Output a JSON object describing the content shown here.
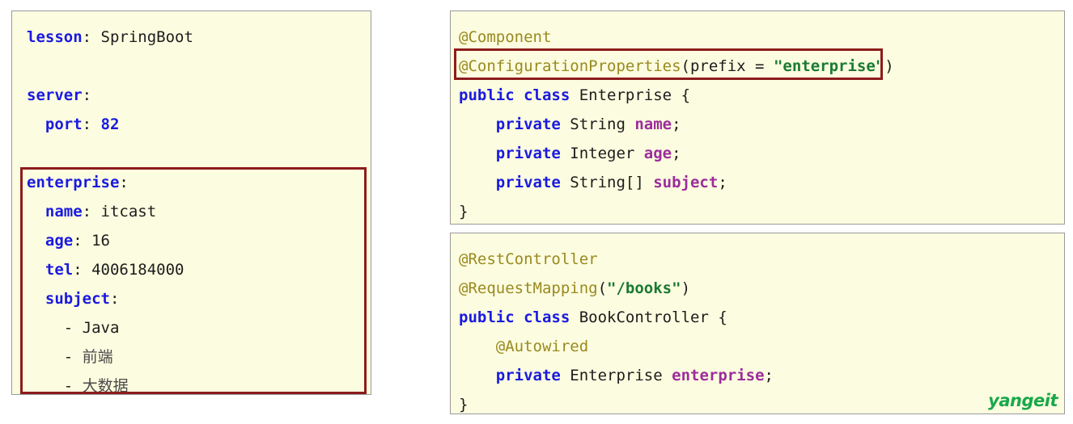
{
  "yaml_panel": {
    "lines": [
      [
        {
          "t": "lesson",
          "c": "key"
        },
        {
          "t": ": ",
          "c": "punc"
        },
        {
          "t": "SpringBoot",
          "c": "plain"
        }
      ],
      [],
      [
        {
          "t": "server",
          "c": "key"
        },
        {
          "t": ":",
          "c": "punc"
        }
      ],
      [
        {
          "t": "  ",
          "c": "plain"
        },
        {
          "t": "port",
          "c": "key"
        },
        {
          "t": ": ",
          "c": "punc"
        },
        {
          "t": "82",
          "c": "num"
        }
      ],
      [],
      [
        {
          "t": "enterprise",
          "c": "key"
        },
        {
          "t": ":",
          "c": "punc"
        }
      ],
      [
        {
          "t": "  ",
          "c": "plain"
        },
        {
          "t": "name",
          "c": "key"
        },
        {
          "t": ": ",
          "c": "punc"
        },
        {
          "t": "itcast",
          "c": "plain"
        }
      ],
      [
        {
          "t": "  ",
          "c": "plain"
        },
        {
          "t": "age",
          "c": "key"
        },
        {
          "t": ": ",
          "c": "punc"
        },
        {
          "t": "16",
          "c": "plain"
        }
      ],
      [
        {
          "t": "  ",
          "c": "plain"
        },
        {
          "t": "tel",
          "c": "key"
        },
        {
          "t": ": ",
          "c": "punc"
        },
        {
          "t": "4006184000",
          "c": "plain"
        }
      ],
      [
        {
          "t": "  ",
          "c": "plain"
        },
        {
          "t": "subject",
          "c": "key"
        },
        {
          "t": ":",
          "c": "punc"
        }
      ],
      [
        {
          "t": "    - ",
          "c": "plain"
        },
        {
          "t": "Java",
          "c": "plain"
        }
      ],
      [
        {
          "t": "    - ",
          "c": "plain"
        },
        {
          "t": "前端",
          "c": "cjk"
        }
      ],
      [
        {
          "t": "    - ",
          "c": "plain"
        },
        {
          "t": "大数据",
          "c": "cjk"
        }
      ]
    ]
  },
  "entity_panel": {
    "lines": [
      [
        {
          "t": "@Component",
          "c": "ann"
        }
      ],
      [
        {
          "t": "@ConfigurationProperties",
          "c": "ann"
        },
        {
          "t": "(prefix = ",
          "c": "punc"
        },
        {
          "t": "\"enterprise\"",
          "c": "str"
        },
        {
          "t": ")",
          "c": "punc"
        }
      ],
      [
        {
          "t": "public",
          "c": "kw"
        },
        {
          "t": " ",
          "c": "plain"
        },
        {
          "t": "class",
          "c": "kw"
        },
        {
          "t": " Enterprise {",
          "c": "type"
        }
      ],
      [
        {
          "t": "    ",
          "c": "plain"
        },
        {
          "t": "private",
          "c": "kw"
        },
        {
          "t": " String ",
          "c": "type"
        },
        {
          "t": "name",
          "c": "field"
        },
        {
          "t": ";",
          "c": "punc"
        }
      ],
      [
        {
          "t": "    ",
          "c": "plain"
        },
        {
          "t": "private",
          "c": "kw"
        },
        {
          "t": " Integer ",
          "c": "type"
        },
        {
          "t": "age",
          "c": "field"
        },
        {
          "t": ";",
          "c": "punc"
        }
      ],
      [
        {
          "t": "    ",
          "c": "plain"
        },
        {
          "t": "private",
          "c": "kw"
        },
        {
          "t": " String[] ",
          "c": "type"
        },
        {
          "t": "subject",
          "c": "field"
        },
        {
          "t": ";",
          "c": "punc"
        }
      ],
      [
        {
          "t": "}",
          "c": "punc"
        }
      ]
    ]
  },
  "controller_panel": {
    "lines": [
      [
        {
          "t": "@RestController",
          "c": "ann"
        }
      ],
      [
        {
          "t": "@RequestMapping",
          "c": "ann"
        },
        {
          "t": "(",
          "c": "punc"
        },
        {
          "t": "\"/books\"",
          "c": "str"
        },
        {
          "t": ")",
          "c": "punc"
        }
      ],
      [
        {
          "t": "public",
          "c": "kw"
        },
        {
          "t": " ",
          "c": "plain"
        },
        {
          "t": "class",
          "c": "kw"
        },
        {
          "t": " BookController {",
          "c": "type"
        }
      ],
      [
        {
          "t": "    ",
          "c": "plain"
        },
        {
          "t": "@Autowired",
          "c": "ann"
        }
      ],
      [
        {
          "t": "    ",
          "c": "plain"
        },
        {
          "t": "private",
          "c": "kw"
        },
        {
          "t": " Enterprise ",
          "c": "type"
        },
        {
          "t": "enterprise",
          "c": "field"
        },
        {
          "t": ";",
          "c": "punc"
        }
      ],
      [
        {
          "t": "}",
          "c": "punc"
        }
      ]
    ]
  },
  "watermark": {
    "text": "yangeit"
  },
  "colors": {
    "panel_background": "#fcfce0",
    "panel_border": "#9a9a9a",
    "highlight_border": "#8d1c1c",
    "yaml_key": "#1a1ae0",
    "keyword": "#1a1ae0",
    "annotation": "#998a1f",
    "string": "#1a7a33",
    "field": "#9b2d9b",
    "watermark": "#18a84a"
  }
}
